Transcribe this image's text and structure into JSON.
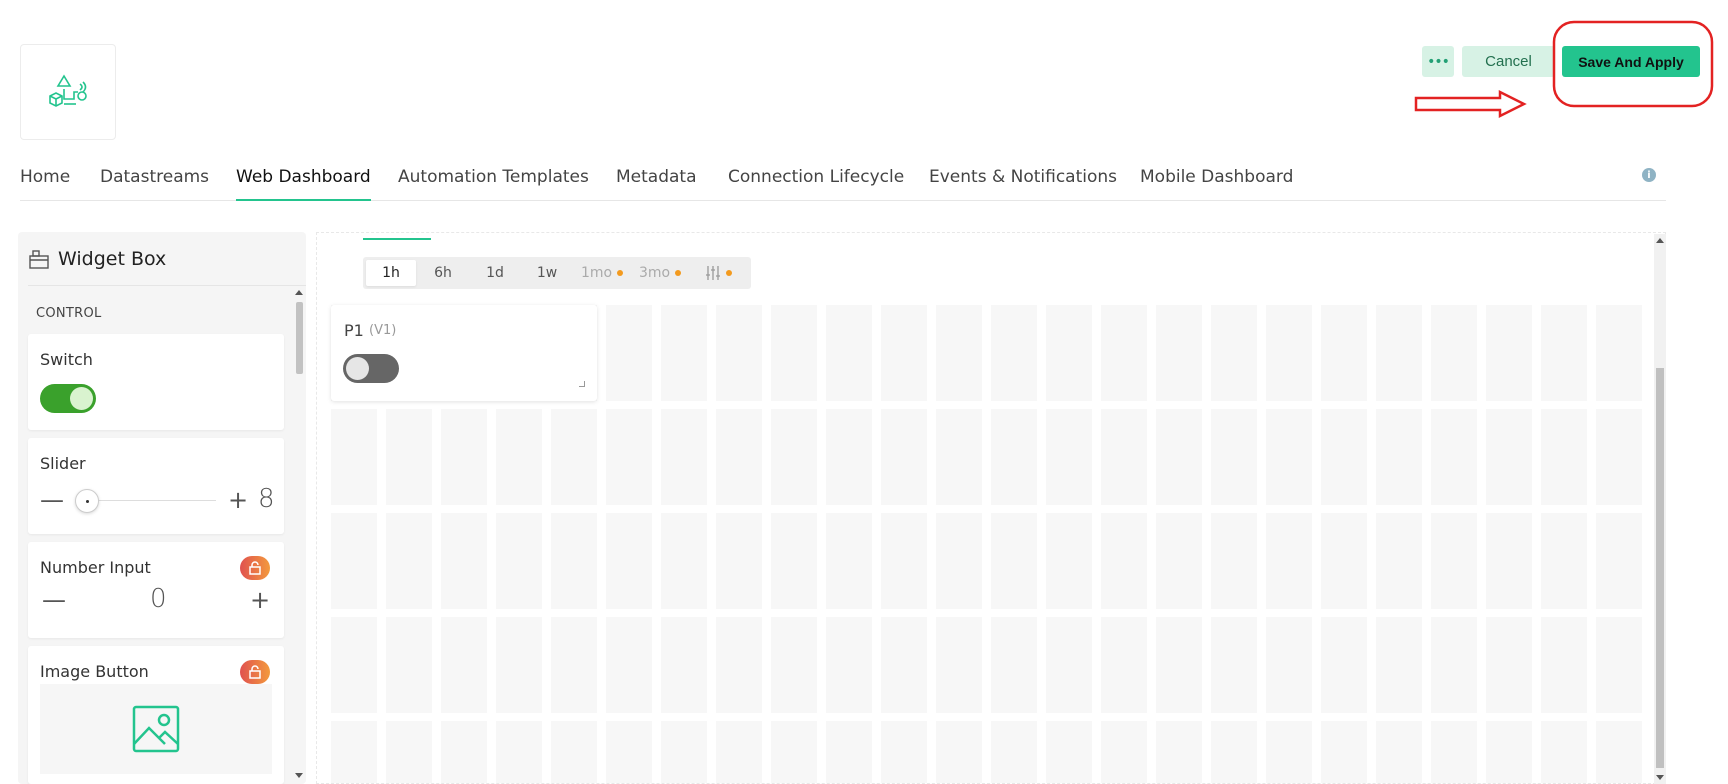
{
  "header": {
    "logo_icon": "blueprint-icon",
    "more_label": "•••",
    "cancel_label": "Cancel",
    "save_label": "Save And Apply",
    "annotation_color": "#e32222"
  },
  "tabs": [
    {
      "label": "Home",
      "active": false
    },
    {
      "label": "Datastreams",
      "active": false
    },
    {
      "label": "Web Dashboard",
      "active": true
    },
    {
      "label": "Automation Templates",
      "active": false
    },
    {
      "label": "Metadata",
      "active": false
    },
    {
      "label": "Connection Lifecycle",
      "active": false
    },
    {
      "label": "Events & Notifications",
      "active": false
    },
    {
      "label": "Mobile Dashboard",
      "active": false
    }
  ],
  "info_label": "i",
  "widget_box": {
    "title": "Widget Box",
    "section_label": "CONTROL",
    "items": [
      {
        "label": "Switch",
        "locked": false
      },
      {
        "label": "Slider",
        "locked": false,
        "minus": "—",
        "plus": "+",
        "value": "8"
      },
      {
        "label": "Number Input",
        "locked": true,
        "minus": "—",
        "plus": "+",
        "value": "0"
      },
      {
        "label": "Image Button",
        "locked": true
      }
    ]
  },
  "time_ranges": [
    {
      "label": "1h",
      "active": true,
      "dot": false,
      "dim": false
    },
    {
      "label": "6h",
      "active": false,
      "dot": false,
      "dim": false
    },
    {
      "label": "1d",
      "active": false,
      "dot": false,
      "dim": false
    },
    {
      "label": "1w",
      "active": false,
      "dot": false,
      "dim": false
    },
    {
      "label": "1mo",
      "active": false,
      "dot": true,
      "dim": true
    },
    {
      "label": "3mo",
      "active": false,
      "dot": true,
      "dim": true
    }
  ],
  "time_custom_icon": "sliders-icon",
  "dashboard_widget": {
    "title": "P1",
    "subtitle": "(V1)",
    "state": "off"
  },
  "colors": {
    "brand": "#23c48e",
    "switch_on": "#3aa12c",
    "switch_off": "#666666",
    "lock_badge": "#e0514f"
  }
}
